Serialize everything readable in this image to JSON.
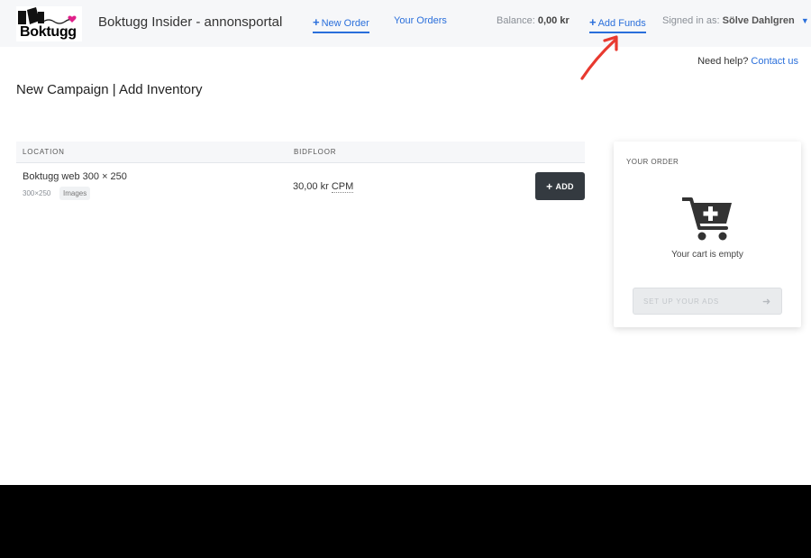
{
  "header": {
    "logo_text": "Boktugg",
    "title": "Boktugg Insider - annonsportal",
    "nav": {
      "new_order": "New Order",
      "your_orders": "Your Orders",
      "add_funds": "Add Funds"
    },
    "balance_label": "Balance:",
    "balance_value": "0,00 kr",
    "signed_in_label": "Signed in as:",
    "user_name": "Sölve Dahlgren"
  },
  "help": {
    "text": "Need help?",
    "link": "Contact us"
  },
  "page_title": "New Campaign | Add Inventory",
  "table": {
    "columns": [
      "LOCATION",
      "BIDFLOOR"
    ],
    "rows": [
      {
        "name": "Boktugg web 300 × 250",
        "size": "300×250",
        "tag": "Images",
        "price": "30,00 kr",
        "unit": "CPM",
        "action": "ADD"
      }
    ]
  },
  "order": {
    "title": "YOUR ORDER",
    "empty_text": "Your cart is empty",
    "setup_button": "SET UP YOUR ADS"
  },
  "icons": {
    "plus": "plus-icon",
    "chevron": "chevron-down-icon",
    "cart": "cart-plus-icon",
    "arrow_right": "arrow-right-icon",
    "annotation": "red-arrow-annotation-icon"
  },
  "colors": {
    "accent": "#2a6fdb",
    "dark_button": "#343a40",
    "annotation": "#e8392f"
  }
}
